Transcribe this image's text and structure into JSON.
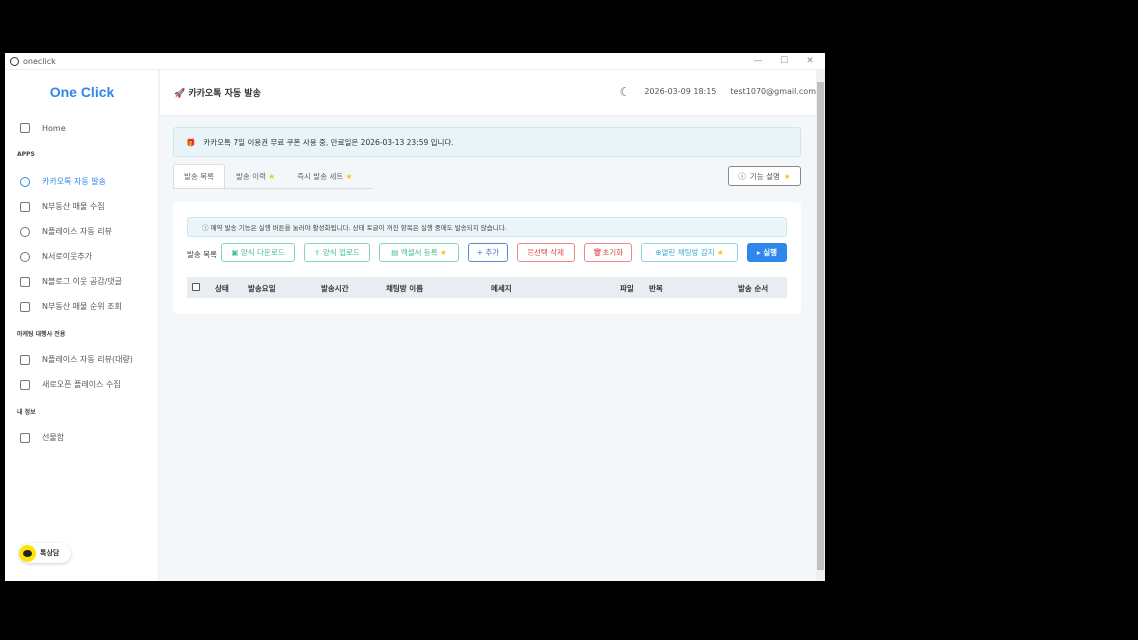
{
  "window": {
    "title": "oneclick"
  },
  "sidebar": {
    "logo": "One Click",
    "home": "Home",
    "sections": [
      "APPS",
      "마케팅 대행사 전용",
      "내 정보"
    ],
    "apps": [
      "카카오톡 자동 발송",
      "N부동산 매물 수집",
      "N플레이스 자동 리뷰",
      "N서로이웃추가",
      "N블로그 이웃 공감/댓글",
      "N부동산 매물 순위 조회"
    ],
    "agency": [
      "N플레이스 자동 리뷰(대량)",
      "새로오픈 플레이스 수집"
    ],
    "mine": [
      "선물함"
    ],
    "kakao_chat": "톡상담"
  },
  "header": {
    "title": "🚀 카카오톡 자동 발송",
    "datetime": "2026-03-09 18:15",
    "email": "test1070@gmail.com"
  },
  "notice": "카카오톡 7일 이용권 무료 쿠폰 사용 중, 만료일은 2026-03-13 23:59 입니다.",
  "tabs": [
    "발송 목록",
    "발송 이력",
    "즉시 발송 세트"
  ],
  "help_button": "기능 설명",
  "info": "ⓘ 예약 발송 기능은 실행 버튼을 눌러야 활성화됩니다. 상태 토글이 꺼진 항목은 실행 중에도 발송되지 않습니다.",
  "toolbar": {
    "label": "발송 목록",
    "buttons": [
      "▣ 양식 다운로드",
      "⇪ 양식 업로드",
      "▤ 엑셀서 등록",
      "+ 추가",
      "⎘선택 삭제",
      "🗑초기화",
      "⊕열린 채팅방 감지",
      "▸ 실행"
    ]
  },
  "table": {
    "columns": [
      "상태",
      "발송요일",
      "발송시간",
      "채팅방 이름",
      "메세지",
      "파일",
      "반복",
      "발송 순서"
    ]
  }
}
